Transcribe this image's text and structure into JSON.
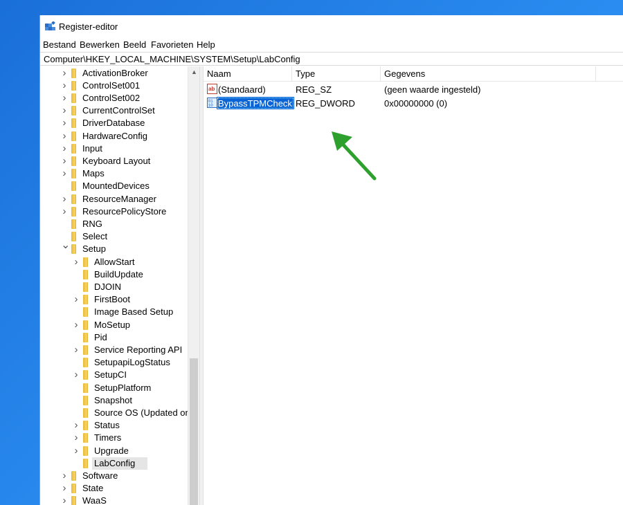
{
  "window": {
    "title": "Register-editor"
  },
  "menu": [
    "Bestand",
    "Bewerken",
    "Beeld",
    "Favorieten",
    "Help"
  ],
  "address": "Computer\\HKEY_LOCAL_MACHINE\\SYSTEM\\Setup\\LabConfig",
  "tree": [
    {
      "label": "ActivationBroker",
      "level": 1,
      "expander": "collapsed"
    },
    {
      "label": "ControlSet001",
      "level": 1,
      "expander": "collapsed"
    },
    {
      "label": "ControlSet002",
      "level": 1,
      "expander": "collapsed"
    },
    {
      "label": "CurrentControlSet",
      "level": 1,
      "expander": "collapsed"
    },
    {
      "label": "DriverDatabase",
      "level": 1,
      "expander": "collapsed"
    },
    {
      "label": "HardwareConfig",
      "level": 1,
      "expander": "collapsed"
    },
    {
      "label": "Input",
      "level": 1,
      "expander": "collapsed"
    },
    {
      "label": "Keyboard Layout",
      "level": 1,
      "expander": "collapsed"
    },
    {
      "label": "Maps",
      "level": 1,
      "expander": "collapsed"
    },
    {
      "label": "MountedDevices",
      "level": 1,
      "expander": "none"
    },
    {
      "label": "ResourceManager",
      "level": 1,
      "expander": "collapsed"
    },
    {
      "label": "ResourcePolicyStore",
      "level": 1,
      "expander": "collapsed"
    },
    {
      "label": "RNG",
      "level": 1,
      "expander": "none"
    },
    {
      "label": "Select",
      "level": 1,
      "expander": "none"
    },
    {
      "label": "Setup",
      "level": 1,
      "expander": "expanded"
    },
    {
      "label": "AllowStart",
      "level": 2,
      "expander": "collapsed"
    },
    {
      "label": "BuildUpdate",
      "level": 2,
      "expander": "none"
    },
    {
      "label": "DJOIN",
      "level": 2,
      "expander": "none"
    },
    {
      "label": "FirstBoot",
      "level": 2,
      "expander": "collapsed"
    },
    {
      "label": "Image Based Setup",
      "level": 2,
      "expander": "none"
    },
    {
      "label": "MoSetup",
      "level": 2,
      "expander": "collapsed"
    },
    {
      "label": "Pid",
      "level": 2,
      "expander": "none"
    },
    {
      "label": "Service Reporting API",
      "level": 2,
      "expander": "collapsed"
    },
    {
      "label": "SetupapiLogStatus",
      "level": 2,
      "expander": "none"
    },
    {
      "label": "SetupCI",
      "level": 2,
      "expander": "collapsed"
    },
    {
      "label": "SetupPlatform",
      "level": 2,
      "expander": "none"
    },
    {
      "label": "Snapshot",
      "level": 2,
      "expander": "none"
    },
    {
      "label": "Source OS (Updated on",
      "level": 2,
      "expander": "none"
    },
    {
      "label": "Status",
      "level": 2,
      "expander": "collapsed"
    },
    {
      "label": "Timers",
      "level": 2,
      "expander": "collapsed"
    },
    {
      "label": "Upgrade",
      "level": 2,
      "expander": "collapsed"
    },
    {
      "label": "LabConfig",
      "level": 2,
      "expander": "none",
      "selected": true
    },
    {
      "label": "Software",
      "level": 1,
      "expander": "collapsed"
    },
    {
      "label": "State",
      "level": 1,
      "expander": "collapsed"
    },
    {
      "label": "WaaS",
      "level": 1,
      "expander": "collapsed"
    }
  ],
  "list": {
    "columns": [
      "Naam",
      "Type",
      "Gegevens"
    ],
    "rows": [
      {
        "name": "(Standaard)",
        "type": "REG_SZ",
        "data": "(geen waarde ingesteld)",
        "icon": "string-value-icon"
      },
      {
        "name": "BypassTPMCheck",
        "type": "REG_DWORD",
        "data": "0x00000000 (0)",
        "icon": "dword-value-icon",
        "selected": true
      }
    ]
  },
  "colors": {
    "selection": "#0a64d6",
    "annotation_arrow": "#2ea02e",
    "desktop": "#1a6fd8"
  }
}
